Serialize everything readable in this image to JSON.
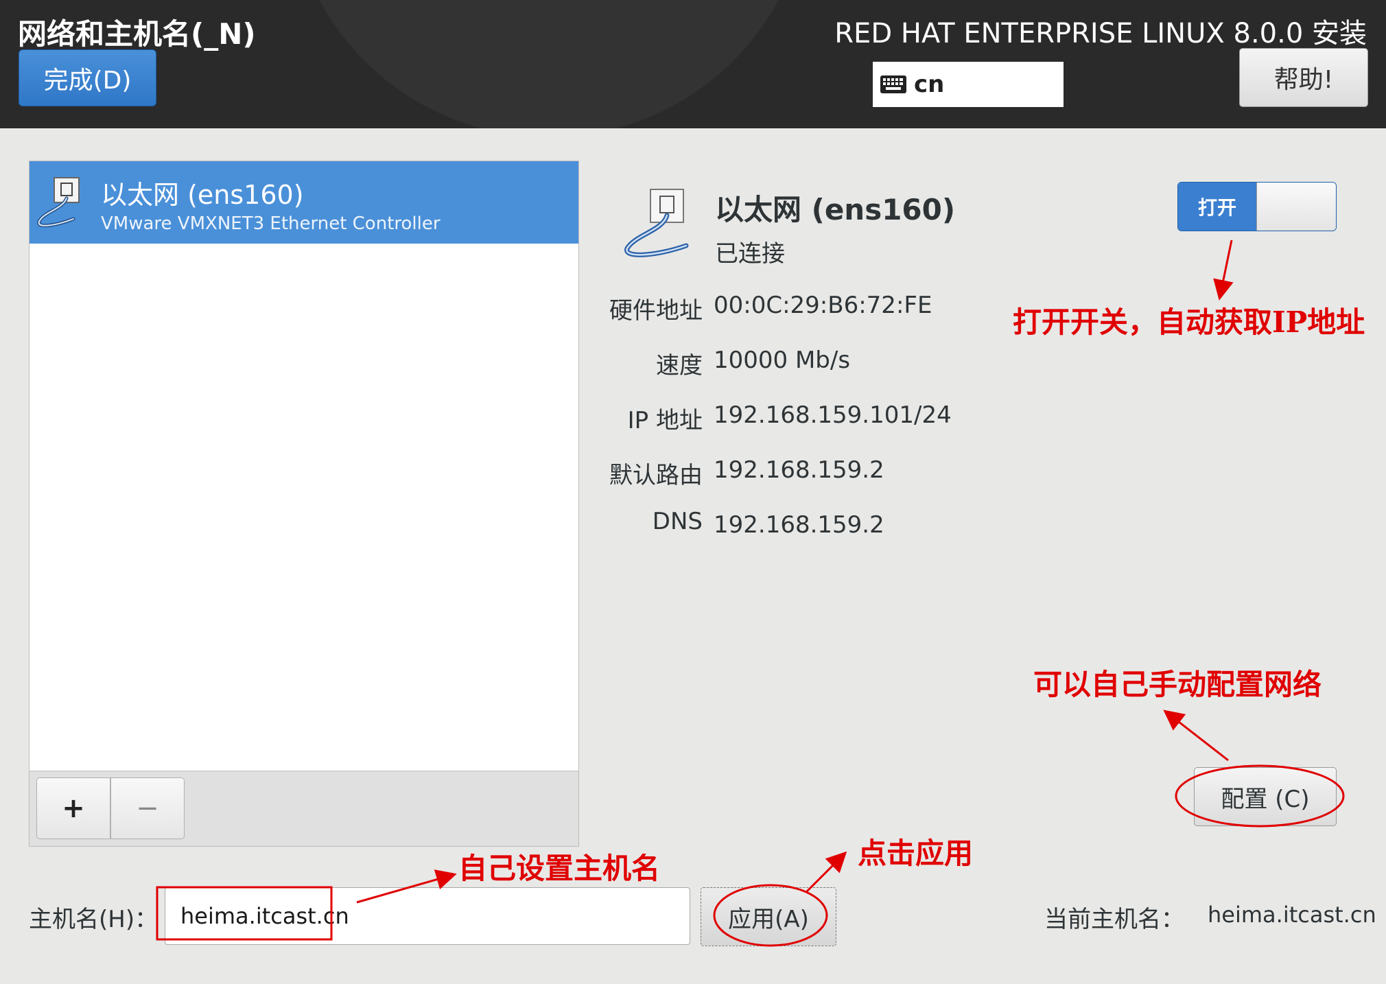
{
  "header": {
    "page_title": "网络和主机名(_N)",
    "done_label": "完成(D)",
    "product_title": "RED HAT ENTERPRISE LINUX 8.0.0 安装",
    "keyboard_layout": "cn",
    "help_label": "帮助!"
  },
  "device_list": {
    "items": [
      {
        "name": "以太网 (ens160)",
        "description": "VMware VMXNET3 Ethernet Controller",
        "selected": true
      }
    ],
    "add_label": "+",
    "remove_label": "−"
  },
  "details": {
    "name": "以太网 (ens160)",
    "status": "已连接",
    "toggle_label": "打开",
    "toggle_on": true,
    "fields": [
      {
        "label": "硬件地址",
        "value": "00:0C:29:B6:72:FE"
      },
      {
        "label": "速度",
        "value": "10000 Mb/s"
      },
      {
        "label": "IP 地址",
        "value": "192.168.159.101/24"
      },
      {
        "label": "默认路由",
        "value": "192.168.159.2"
      },
      {
        "label": "DNS",
        "value": "192.168.159.2"
      }
    ],
    "configure_label": "配置 (C)"
  },
  "hostname": {
    "label": "主机名(H)：",
    "value": "heima.itcast.cn",
    "apply_label": "应用(A)",
    "current_label": "当前主机名：",
    "current_value": "heima.itcast.cn"
  },
  "annotations": {
    "toggle_note": "打开开关，自动获取IP地址",
    "config_note": "可以自己手动配置网络",
    "apply_note": "点击应用",
    "hostname_note": "自己设置主机名"
  },
  "colors": {
    "accent": "#4a90d9",
    "header_bg": "#2a2a2a",
    "annotation": "#e00000"
  }
}
